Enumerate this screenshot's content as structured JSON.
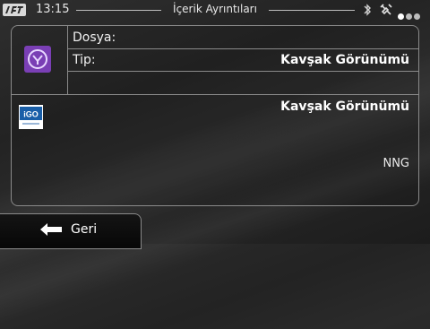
{
  "status": {
    "time": "13:15",
    "title": "İçerik Ayrıntıları"
  },
  "details": {
    "file_label": "Dosya:",
    "file_value": "",
    "type_label": "Tip:",
    "type_value": "Kavşak Görünümü"
  },
  "item": {
    "name": "Kavşak Görünümü",
    "publisher": "NNG",
    "icon_text": "iGO"
  },
  "footer": {
    "back_label": "Geri"
  },
  "colors": {
    "accent_purple": "#7a3fb5",
    "igo_blue": "#1a5fa8"
  }
}
